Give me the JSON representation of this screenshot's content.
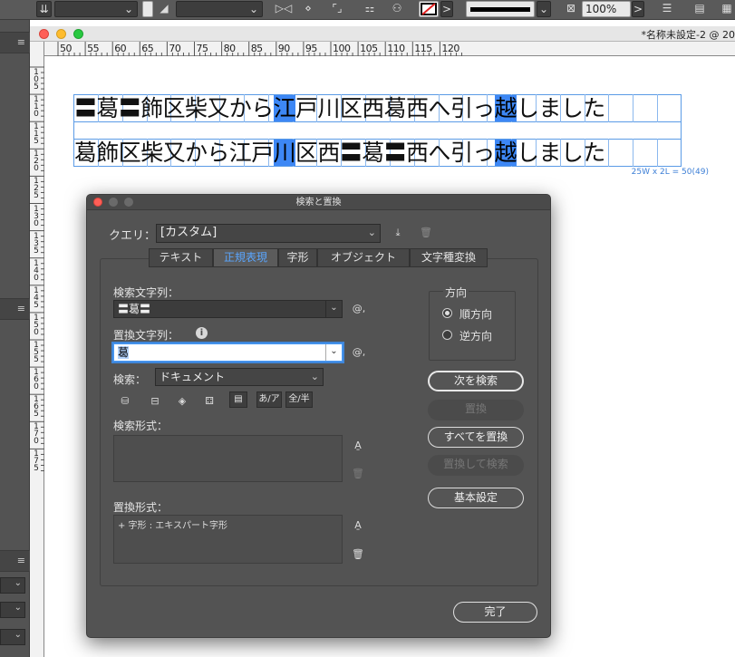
{
  "control_bar": {
    "zoom": "100%",
    "zoom_arrow": ">",
    "arrow": ">"
  },
  "document": {
    "title": "*名称未設定-2 @ 20",
    "ruler_h_labels": [
      "50",
      "55",
      "60",
      "65",
      "70",
      "75",
      "80",
      "85",
      "90",
      "95",
      "100",
      "105",
      "110",
      "115",
      "120"
    ],
    "ruler_v_labels": [
      "105",
      "110",
      "115",
      "120",
      "125",
      "130",
      "135",
      "140",
      "145",
      "150",
      "155",
      "160",
      "165",
      "170",
      "175"
    ],
    "line1": [
      "〓葛〓飾区柴又から",
      "江",
      "戸川区西葛西へ引っ",
      "越",
      "しました"
    ],
    "line2": [
      "葛飾区柴又から江戸",
      "川",
      "区西〓葛〓西へ引っ",
      "越",
      "しました"
    ],
    "frame_info": "25W x 2L = 50(49)"
  },
  "dialog": {
    "title": "検索と置換",
    "query_label": "クエリ：",
    "query_value": "[カスタム]",
    "tabs": [
      {
        "label": "テキスト",
        "active": false
      },
      {
        "label": "正規表現",
        "active": true
      },
      {
        "label": "字形",
        "active": false
      },
      {
        "label": "オブジェクト",
        "active": false
      },
      {
        "label": "文字種変換",
        "active": false
      }
    ],
    "find_label": "検索文字列：",
    "find_value": "〓葛〓",
    "change_label": "置換文字列：",
    "change_value": "葛",
    "search_label": "検索：",
    "search_value": "ドキュメント",
    "find_format_label": "検索形式：",
    "change_format_label": "置換形式：",
    "change_format_value": "+ 字形 : エキスパート字形",
    "direction_title": "方向",
    "direction_forward": "順方向",
    "direction_backward": "逆方向",
    "buttons": {
      "find_next": "次を検索",
      "change": "置換",
      "change_all": "すべてを置換",
      "change_find": "置換して検索",
      "fewer_options": "基本設定",
      "done": "完了"
    },
    "option_icons": {
      "kana": "あ/ア",
      "width": "全/半"
    },
    "at_symbol": "@,"
  },
  "colors": {
    "highlight": "#3d87f5",
    "active_tab": "#5aa6ff",
    "dialog_bg": "#535353"
  }
}
